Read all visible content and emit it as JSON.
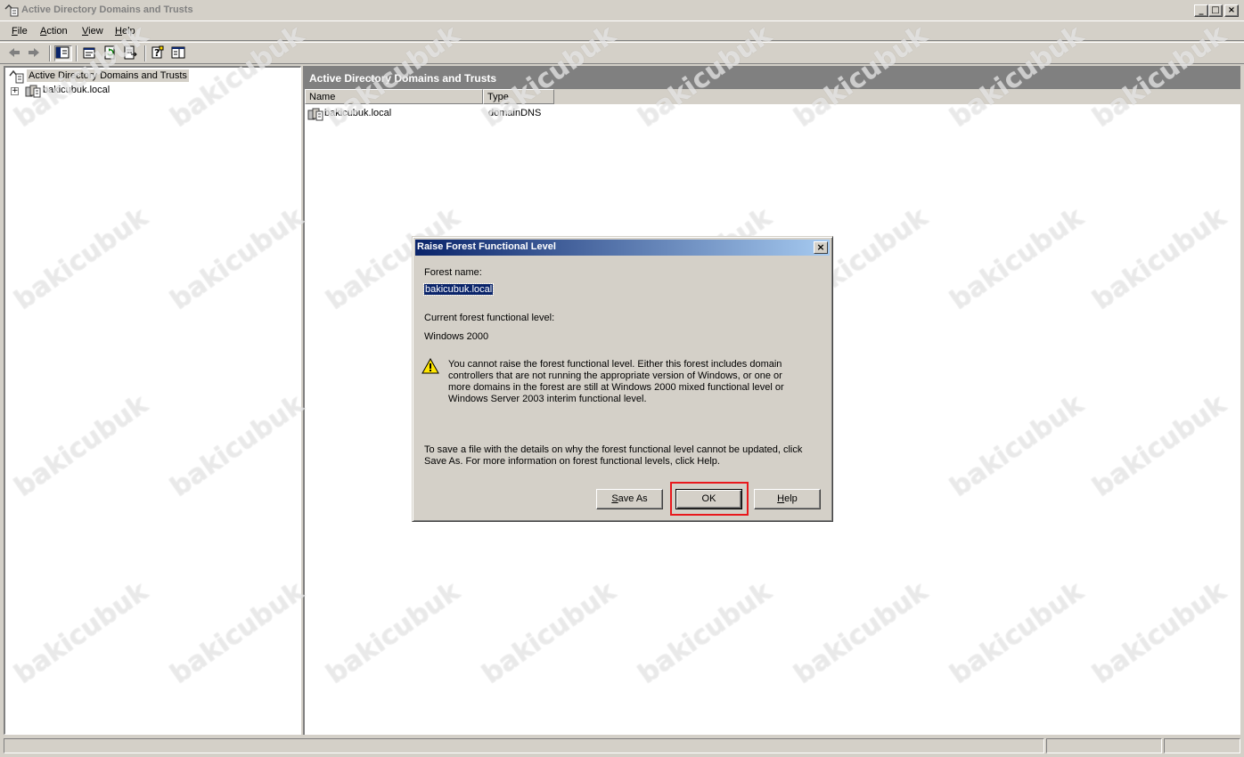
{
  "window": {
    "title": "Active Directory Domains and Trusts",
    "controls": {
      "minimize": "_",
      "maximize": "□",
      "close": "×"
    }
  },
  "menu": [
    {
      "label": "File",
      "key": "F",
      "rest": "ile"
    },
    {
      "label": "Action",
      "key": "A",
      "rest": "ction"
    },
    {
      "label": "View",
      "key": "V",
      "rest": "iew"
    },
    {
      "label": "Help",
      "key": "H",
      "rest": "elp"
    }
  ],
  "toolbar": {
    "icons": [
      "back-arrow-icon",
      "forward-arrow-icon",
      "show-hide-tree-icon",
      "properties-icon",
      "refresh-icon",
      "export-list-icon",
      "help-icon",
      "mmc-pane-icon"
    ]
  },
  "tree": {
    "root_label": "Active Directory Domains and Trusts",
    "children": [
      {
        "label": "bakicubuk.local",
        "expander": "+"
      }
    ]
  },
  "results": {
    "header": "Active Directory Domains and Trusts",
    "columns": [
      "Name",
      "Type"
    ],
    "rows": [
      {
        "name": "bakicubuk.local",
        "type": "domainDNS"
      }
    ]
  },
  "dialog": {
    "title": "Raise Forest Functional Level",
    "close_glyph": "×",
    "forest_name_label": "Forest name:",
    "forest_name_value": "bakicubuk.local",
    "current_level_label": "Current forest functional level:",
    "current_level_value": "Windows 2000",
    "warning_text": "You cannot raise the forest functional level. Either this forest includes domain controllers that are not running the appropriate version of Windows, or one or more domains in the forest are still at Windows 2000 mixed functional level or Windows Server 2003 interim functional level.",
    "save_info_text": "To save a file with the details on why the forest functional level cannot be updated, click Save As. For more information on forest functional levels, click Help.",
    "buttons": {
      "save_as": {
        "key": "S",
        "rest": "ave As"
      },
      "ok": "OK",
      "help": {
        "key": "H",
        "rest": "elp"
      }
    }
  },
  "watermark": "bakicubuk",
  "colors": {
    "dialog_title_start": "#0a246a",
    "dialog_title_end": "#a6caf0",
    "result_header": "#808080",
    "highlight_box": "#e8181c",
    "face": "#d4d0c8"
  }
}
